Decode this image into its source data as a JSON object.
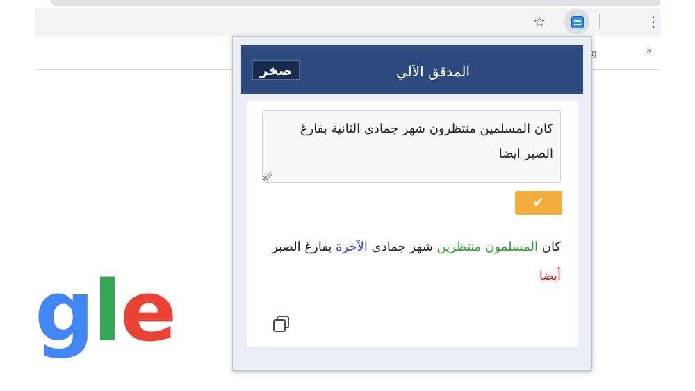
{
  "browser": {
    "star_icon": "star-outline-icon",
    "extension_icon": "al-mudaqqiq-extension-icon",
    "menu_icon": "vertical-dots-icon",
    "bookmarks_overflow": "»",
    "bookmark_glyph": "g"
  },
  "page": {
    "logo_fragment": {
      "g": "g",
      "l": "l",
      "e": "e"
    }
  },
  "popup": {
    "brand_logo": "صخر",
    "title": "المدقق الآلي",
    "input_text": "كان المسلمين منتظرون شهر جمادى الثانية بفارغ الصبر ايضا",
    "check_label": "✔",
    "result_segments": [
      {
        "text": "كان ",
        "status": "unchanged"
      },
      {
        "text": "المسلمون منتظرين",
        "status": "grammar"
      },
      {
        "text": " شهر جمادى ",
        "status": "unchanged"
      },
      {
        "text": "الآخرة",
        "status": "lexical"
      },
      {
        "text": " بفارغ الصبر ",
        "status": "unchanged"
      },
      {
        "text": "أيضا",
        "status": "spelling"
      }
    ],
    "copy_icon": "copy-icon"
  },
  "colors": {
    "header_blue": "#2c4a7e",
    "check_orange": "#f0ad3c",
    "grammar_green": "#2e9e2e",
    "lexical_blue": "#2d3ff0",
    "spelling_red": "#d62020"
  }
}
